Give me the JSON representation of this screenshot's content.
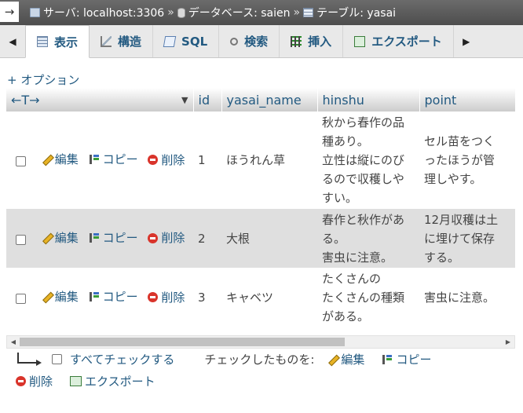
{
  "breadcrumb": {
    "arrow": "→",
    "server_label": "サーバ: localhost:3306",
    "sep1": "»",
    "database_label": "データベース: saien",
    "sep2": "»",
    "table_label": "テーブル: yasai"
  },
  "tabs": [
    {
      "label": "表示",
      "icon": "browse-icon",
      "active": true
    },
    {
      "label": "構造",
      "icon": "structure-icon"
    },
    {
      "label": "SQL",
      "icon": "sql-icon"
    },
    {
      "label": "検索",
      "icon": "search-icon"
    },
    {
      "label": "挿入",
      "icon": "insert-icon"
    },
    {
      "label": "エクスポート",
      "icon": "export-icon"
    }
  ],
  "tab_nav": {
    "prev": "◀",
    "next": "▶"
  },
  "options_link": "+ オプション",
  "table": {
    "col_arrows": "←T→",
    "sort_indicator": "▼",
    "columns": [
      "id",
      "yasai_name",
      "hinshu",
      "point"
    ],
    "actions": {
      "edit": "編集",
      "copy": "コピー",
      "delete": "削除"
    },
    "rows": [
      {
        "id": "1",
        "yasai_name": "ほうれん草",
        "hinshu": "秋から春作の品\n種あり。\n立性は縦にのび\nるので収穫しや\nすい。",
        "point": "セル苗をつく\nったほうが管\n理しやす。"
      },
      {
        "id": "2",
        "yasai_name": "大根",
        "hinshu": "春作と秋作があ\nる。\n害虫に注意。",
        "point": "12月収穫は土\nに埋けて保存\nする。"
      },
      {
        "id": "3",
        "yasai_name": "キャベツ",
        "hinshu": "たくさんの\nたくさんの種類\nがある。",
        "point": "害虫に注意。"
      }
    ]
  },
  "scrollbar": {
    "left": "◀",
    "right": "▶"
  },
  "bulk": {
    "check_all": "すべてチェックする",
    "with_selected": "チェックしたものを:",
    "edit": "編集",
    "copy": "コピー",
    "delete": "削除",
    "export": "エクスポート"
  }
}
